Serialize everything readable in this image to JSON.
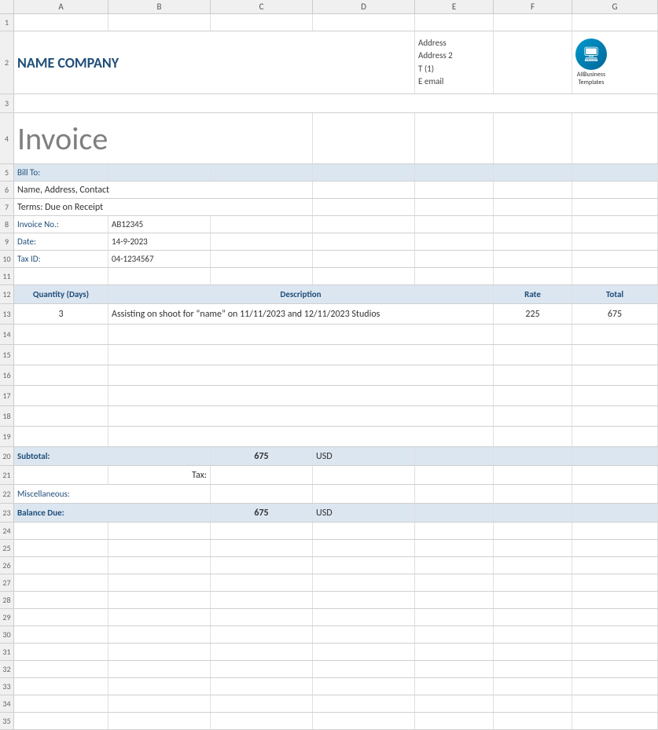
{
  "columns": {
    "headers": [
      "",
      "A",
      "B",
      "C",
      "D",
      "E",
      "F",
      "G"
    ]
  },
  "rows": {
    "row1": {
      "num": "1"
    },
    "row2": {
      "num": "2",
      "company_name": "NAME COMPANY",
      "address_line1": "Address",
      "address_line2": "Address 2",
      "address_line3": "T (1)",
      "address_line4": "E email",
      "logo_line1": "AllBusiness",
      "logo_line2": "Templates"
    },
    "row3": {
      "num": "3"
    },
    "row4": {
      "num": "4",
      "invoice_title": "Invoice"
    },
    "row5": {
      "num": "5",
      "bill_to": "Bill To:"
    },
    "row6": {
      "num": "6",
      "bill_info": "Name, Address, Contact"
    },
    "row7": {
      "num": "7",
      "terms_label": "Terms: Due on Receipt"
    },
    "row8": {
      "num": "8",
      "invoice_label": "Invoice No.:",
      "invoice_value": "AB12345"
    },
    "row9": {
      "num": "9",
      "date_label": "Date:",
      "date_value": "14-9-2023"
    },
    "row10": {
      "num": "10",
      "tax_label": "Tax ID:",
      "tax_value": "04-1234567"
    },
    "row11": {
      "num": "11"
    },
    "row12": {
      "num": "12",
      "col_qty": "Quantity (Days)",
      "col_desc": "Description",
      "col_rate": "Rate",
      "col_total": "Total"
    },
    "row13": {
      "num": "13",
      "qty": "3",
      "desc": "Assisting on shoot for “name” on 11/11/2023 and 12/11/2023 Studios",
      "rate": "225",
      "total": "675"
    },
    "row14": {
      "num": "14"
    },
    "row15": {
      "num": "15"
    },
    "row16": {
      "num": "16"
    },
    "row17": {
      "num": "17"
    },
    "row18": {
      "num": "18"
    },
    "row19": {
      "num": "19"
    },
    "row20": {
      "num": "20",
      "subtotal_label": "Subtotal:",
      "subtotal_value": "675",
      "subtotal_currency": "USD"
    },
    "row21": {
      "num": "21",
      "tax_row_label": "Tax:"
    },
    "row22": {
      "num": "22",
      "misc_label": "Miscellaneous:"
    },
    "row23": {
      "num": "23",
      "balance_label": "Balance Due:",
      "balance_value": "675",
      "balance_currency": "USD"
    },
    "rows_empty": [
      "24",
      "25",
      "26",
      "27",
      "28",
      "29",
      "30",
      "31",
      "32",
      "33",
      "34",
      "35"
    ]
  }
}
